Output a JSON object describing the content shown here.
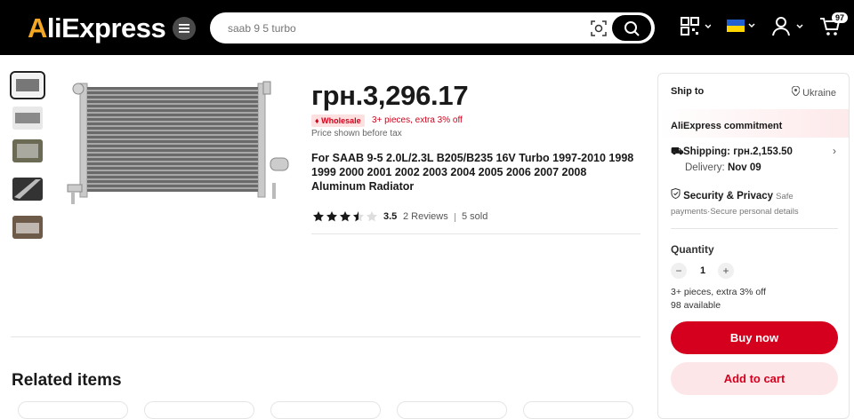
{
  "header": {
    "logo_text_main": "liExpress",
    "logo_text_a": "A",
    "search_placeholder": "saab 9 5 turbo",
    "cart_count": "97"
  },
  "product": {
    "price": "грн.3,296.17",
    "wholesale_badge": "Wholesale",
    "wholesale_text": "3+ pieces, extra 3% off",
    "tax_note": "Price shown before tax",
    "title": "For SAAB 9-5 2.0L/2.3L B205/B235 16V Turbo 1997-2010 1998 1999 2000 2001 2002 2003 2004 2005 2006 2007 2008 Aluminum Radiator",
    "rating": "3.5",
    "stars": 3.5,
    "reviews": "2 Reviews",
    "sold": "5 sold"
  },
  "related": {
    "title": "Related items"
  },
  "panel": {
    "ship_to_label": "Ship to",
    "ship_to_location": "Ukraine",
    "commitment_title": "AliExpress commitment",
    "shipping": "Shipping: грн.2,153.50",
    "delivery_label": "Delivery:",
    "delivery_date": "Nov 09",
    "security_title": "Security & Privacy",
    "security_sub_1": "Safe",
    "security_sub_2": "payments·Secure personal details",
    "quantity_label": "Quantity",
    "quantity_value": "1",
    "qty_minus": "−",
    "qty_plus": "+",
    "qty_offer": "3+ pieces, extra 3% off",
    "qty_available": "98 available",
    "buy_now": "Buy now",
    "add_to_cart": "Add to cart"
  },
  "colors": {
    "accent_red": "#d4001e",
    "logo_orange": "#f5a623",
    "header_bg": "#000000"
  }
}
